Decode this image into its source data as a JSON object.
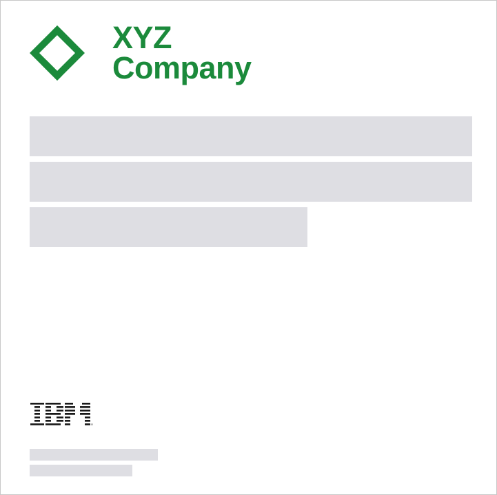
{
  "company_logo": {
    "line1": "XYZ",
    "line2": "Company",
    "brand_color": "#1b8a3b",
    "icon": "xyz-diamond-logo-icon"
  },
  "title_placeholder": {
    "color": "#dedee3",
    "lines": 3
  },
  "footer": {
    "logo_text": "IBM",
    "logo_color": "#1a1a1a",
    "meta_placeholder_lines": 2
  }
}
